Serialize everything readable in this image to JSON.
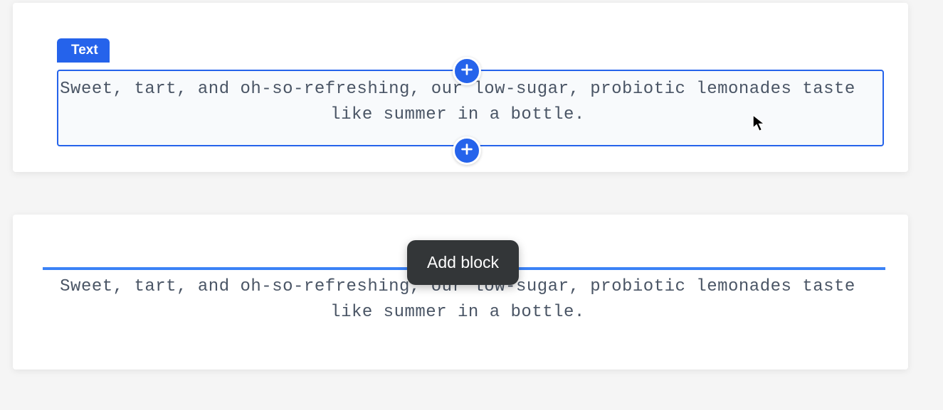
{
  "block_label": "Text",
  "body_text": "Sweet, tart, and oh-so-refreshing, our low-sugar, probiotic lemonades taste like summer in a bottle.",
  "tooltip_label": "Add block",
  "colors": {
    "primary": "#2563eb",
    "tooltip_bg": "#333638",
    "text": "#4a5565"
  }
}
